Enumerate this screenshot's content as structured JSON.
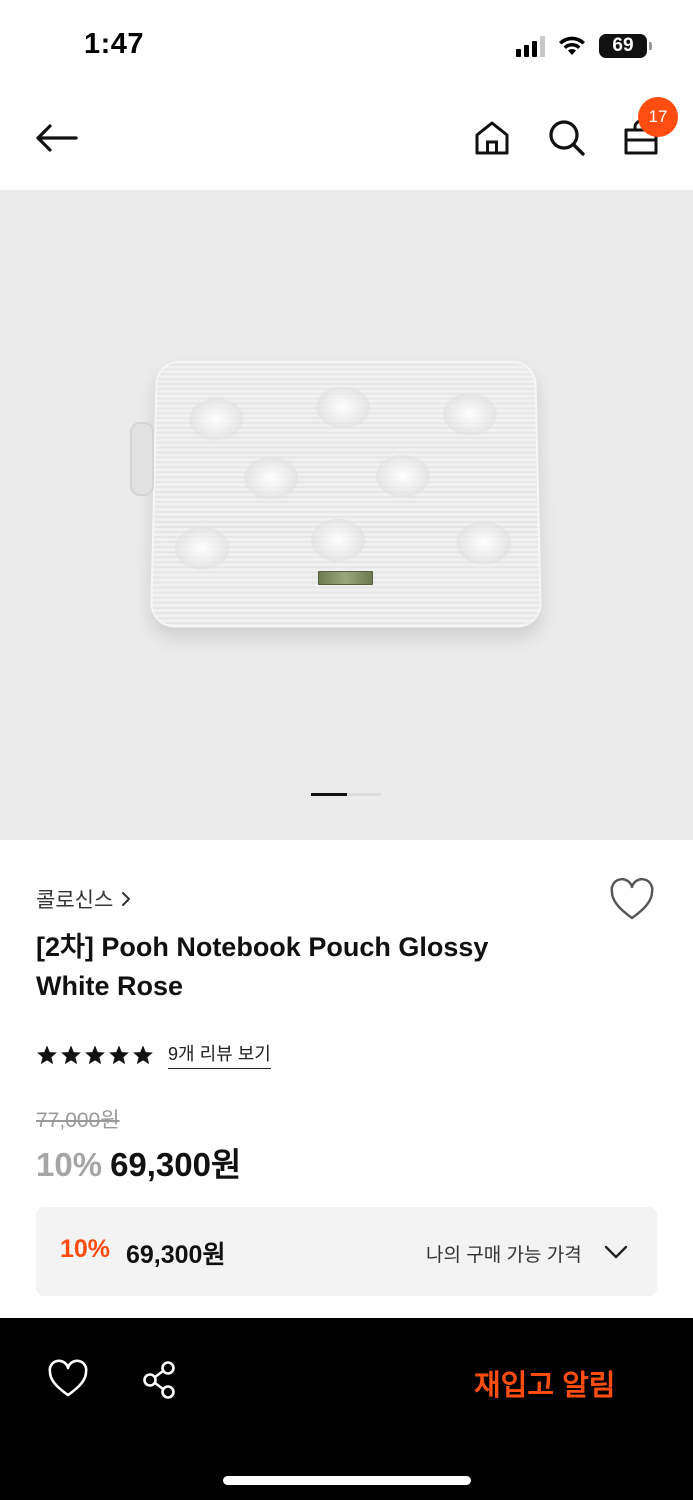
{
  "status_bar": {
    "time": "1:47",
    "battery": "69"
  },
  "header": {
    "cart_count": "17"
  },
  "product": {
    "brand": "콜로신스",
    "title": "[2차] Pooh Notebook Pouch Glossy White Rose",
    "rating_stars": 5,
    "review_link": "9개 리뷰 보기",
    "original_price": "77,000원",
    "discount": "10%",
    "sale_price": "69,300원"
  },
  "my_price": {
    "discount": "10%",
    "amount": "69,300원",
    "label": "나의 구매 가능 가격"
  },
  "bottom_bar": {
    "restock_label": "재입고 알림"
  },
  "colors": {
    "accent": "#ff4d12",
    "bar": "#000000",
    "image_bg": "#ebebeb"
  }
}
